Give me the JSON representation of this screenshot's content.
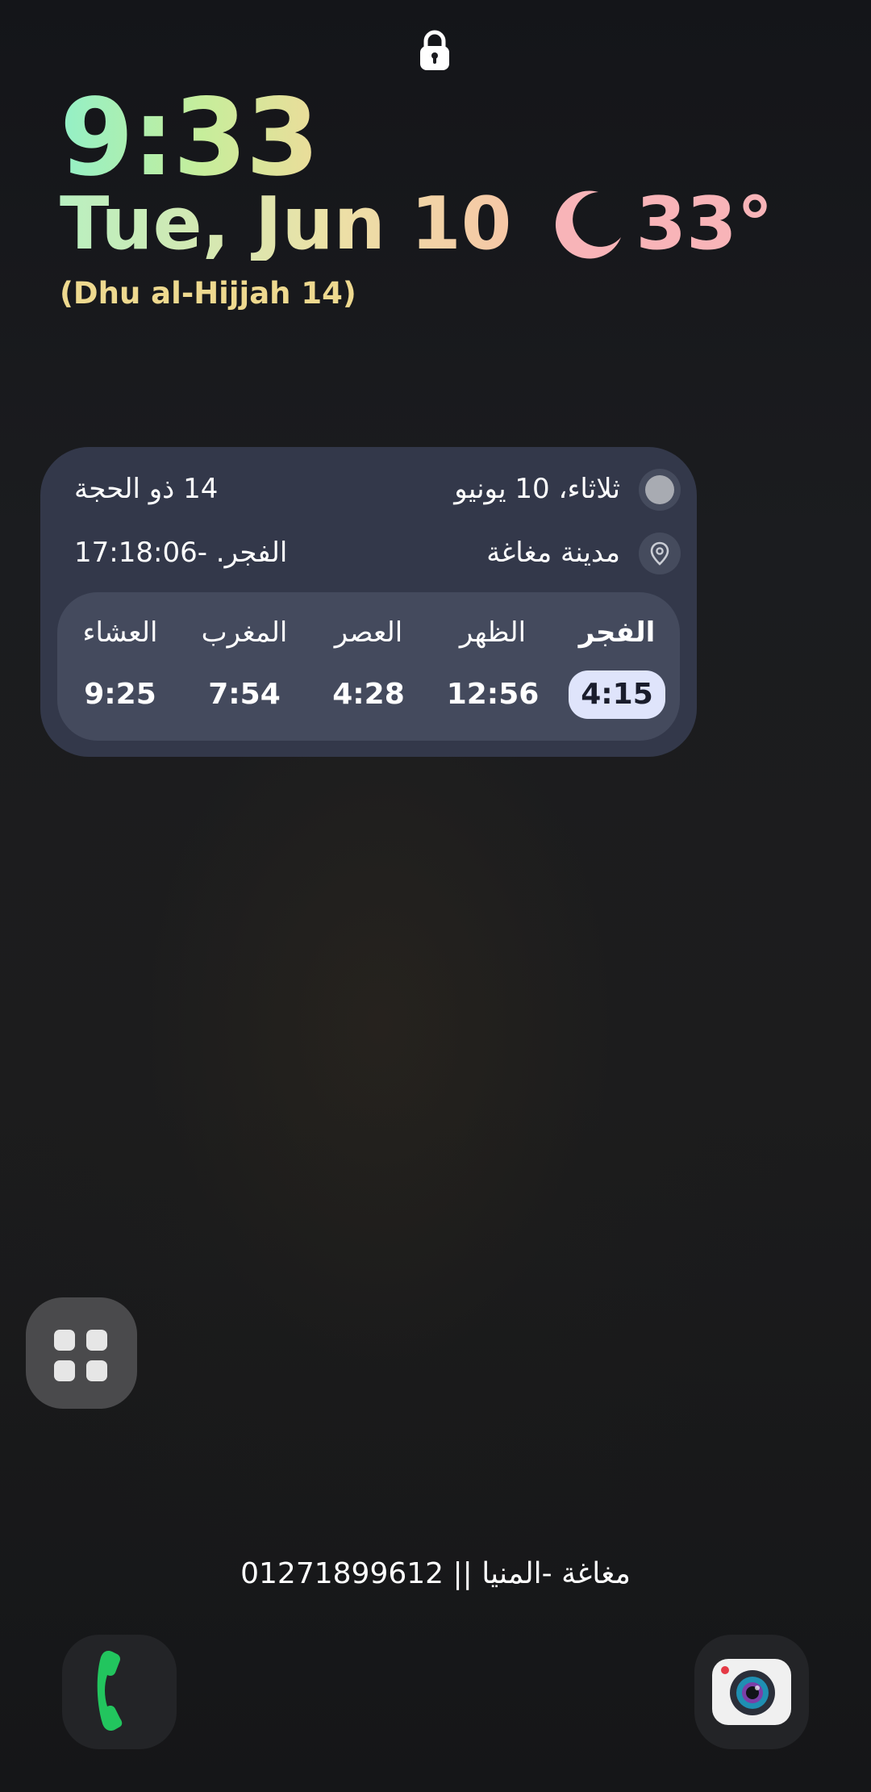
{
  "lockscreen": {
    "time": "9:33",
    "date": "Tue, Jun 10",
    "weather_icon": "moon-icon",
    "temperature": "33°",
    "hijri": "(Dhu al-Hijjah 14)"
  },
  "widget": {
    "gregorian_date": "ثلاثاء، 10 يونيو",
    "hijri_date": "14 ذو الحجة",
    "location": "مدينة مغاغة",
    "countdown": "الفجر. -17:18:06",
    "prayers": [
      {
        "name": "الفجر",
        "time": "4:15",
        "active": true
      },
      {
        "name": "الظهر",
        "time": "12:56",
        "active": false
      },
      {
        "name": "العصر",
        "time": "4:28",
        "active": false
      },
      {
        "name": "المغرب",
        "time": "7:54",
        "active": false
      },
      {
        "name": "العشاء",
        "time": "9:25",
        "active": false
      }
    ]
  },
  "footer": {
    "owner_info": "مغاغة -المنيا || 01271899612"
  },
  "dock": {
    "left_app": "phone-icon",
    "right_app": "camera-icon"
  },
  "colors": {
    "clock_gradient_start": "#93f0c7",
    "clock_gradient_end": "#ecdc9a",
    "temperature": "#f8b4b8",
    "hijri": "#eed98f",
    "widget_bg": "#33384a",
    "widget_inner_bg": "#444a5d",
    "active_prayer_bg": "#dfe4fb",
    "phone_green": "#22c55e"
  }
}
